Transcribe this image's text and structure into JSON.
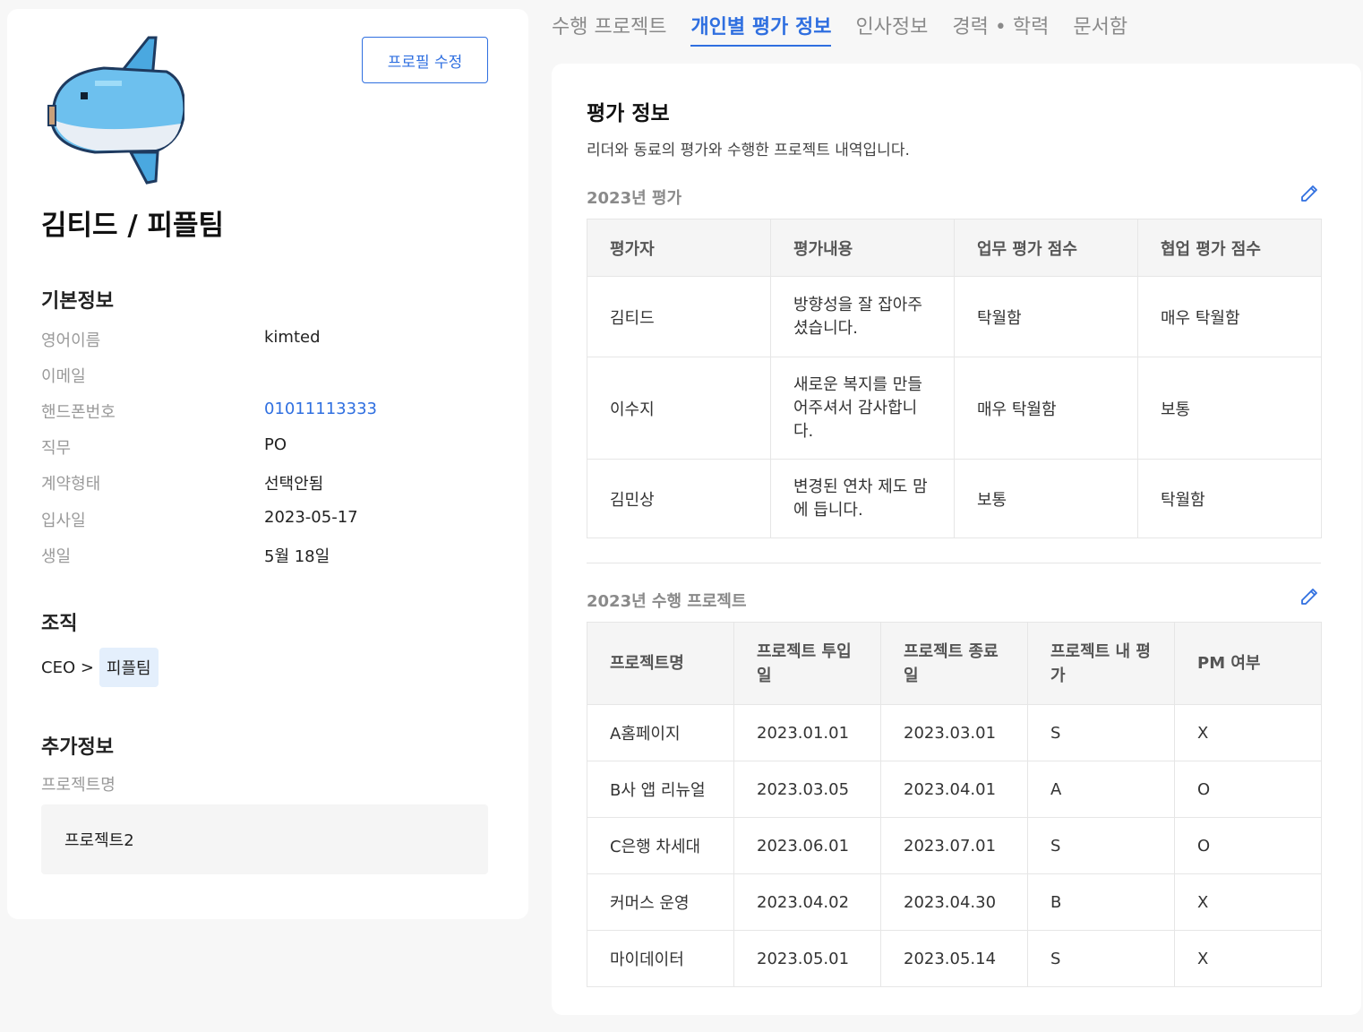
{
  "profile": {
    "edit_button": "프로필 수정",
    "name": "김티드 / 피플팀"
  },
  "basic_info": {
    "title": "기본정보",
    "rows": [
      {
        "label": "영어이름",
        "value": "kimted"
      },
      {
        "label": "이메일",
        "value": ""
      },
      {
        "label": "핸드폰번호",
        "value": "01011113333"
      },
      {
        "label": "직무",
        "value": "PO"
      },
      {
        "label": "계약형태",
        "value": "선택안됨"
      },
      {
        "label": "입사일",
        "value": "2023-05-17"
      },
      {
        "label": "생일",
        "value": "5월 18일"
      }
    ]
  },
  "organization": {
    "title": "조직",
    "ceo": "CEO >",
    "team": "피플팀"
  },
  "extra_info": {
    "title": "추가정보",
    "project_label": "프로젝트명",
    "project_value": "프로젝트2"
  },
  "tabs": [
    "수행 프로젝트",
    "개인별 평가 정보",
    "인사정보",
    "경력 • 학력",
    "문서함"
  ],
  "active_tab": "개인별 평가 정보",
  "evaluation": {
    "title": "평가 정보",
    "description": "리더와 동료의 평가와 수행한 프로젝트 내역입니다.",
    "eval_section_title": "2023년 평가",
    "eval_headers": [
      "평가자",
      "평가내용",
      "업무 평가 점수",
      "협업 평가 점수"
    ],
    "eval_rows": [
      [
        "김티드",
        "방향성을 잘 잡아주셨습니다.",
        "탁월함",
        "매우 탁월함"
      ],
      [
        "이수지",
        "새로운 복지를 만들어주셔서 감사합니다.",
        "매우 탁월함",
        "보통"
      ],
      [
        "김민상",
        "변경된 연차 제도 맘에 듭니다.",
        "보통",
        "탁월함"
      ]
    ],
    "project_section_title": "2023년 수행 프로젝트",
    "project_headers": [
      "프로젝트명",
      "프로젝트 투입일",
      "프로젝트 종료일",
      "프로젝트 내 평가",
      "PM 여부"
    ],
    "project_rows": [
      [
        "A홈페이지",
        "2023.01.01",
        "2023.03.01",
        "S",
        "X"
      ],
      [
        "B사 앱 리뉴얼",
        "2023.03.05",
        "2023.04.01",
        "A",
        "O"
      ],
      [
        "C은행 차세대",
        "2023.06.01",
        "2023.07.01",
        "S",
        "O"
      ],
      [
        "커머스 운영",
        "2023.04.02",
        "2023.04.30",
        "B",
        "X"
      ],
      [
        "마이데이터",
        "2023.05.01",
        "2023.05.14",
        "S",
        "X"
      ]
    ]
  },
  "colors": {
    "accent": "#2f6fe0",
    "chip_bg": "#e4effc",
    "avatar_body": "#4aa8e0",
    "avatar_belly": "#e8eef5"
  }
}
